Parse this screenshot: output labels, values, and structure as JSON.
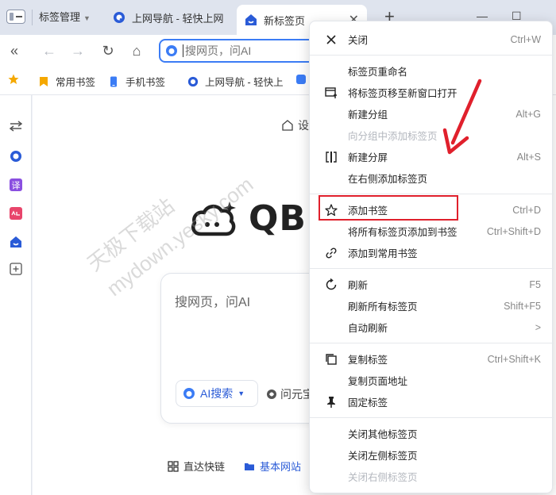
{
  "tabstrip": {
    "tab_manager_label": "标签管理",
    "tabs": [
      {
        "label": "上网导航 - 轻快上网",
        "active": false
      },
      {
        "label": "新标签页",
        "active": true
      }
    ]
  },
  "navbar": {
    "address_placeholder": "搜网页，问AI"
  },
  "bookmarks": {
    "items": [
      {
        "label": "常用书签"
      },
      {
        "label": "手机书签"
      },
      {
        "label": "上网导航 - 轻快上"
      }
    ]
  },
  "sidebar": {
    "icons": [
      "collapse-icon",
      "qbrowser-icon",
      "translate-icon",
      "app-icon",
      "home-icon",
      "add-icon"
    ]
  },
  "content": {
    "settings_label": "设",
    "logo_text": "QB",
    "search_placeholder": "搜网页，问AI",
    "ai_search_label": "AI搜索",
    "wen_label": "问元宝",
    "quick_links": [
      {
        "label": "直达快链"
      },
      {
        "label": "基本网站"
      }
    ],
    "watermark_line1": "天极下载站",
    "watermark_line2": "mydown.yesky.com"
  },
  "menu": {
    "items": [
      {
        "label": "关闭",
        "shortcut": "Ctrl+W",
        "icon": "close-icon",
        "disabled": false
      },
      {
        "label": "标签页重命名",
        "shortcut": "",
        "icon": "",
        "disabled": false
      },
      {
        "label": "将标签页移至新窗口打开",
        "shortcut": "",
        "icon": "move-window-icon",
        "disabled": false
      },
      {
        "label": "新建分组",
        "shortcut": "Alt+G",
        "icon": "",
        "disabled": false
      },
      {
        "label": "向分组中添加标签页",
        "shortcut": "",
        "icon": "",
        "disabled": true
      },
      {
        "label": "新建分屏",
        "shortcut": "Alt+S",
        "icon": "split-screen-icon",
        "disabled": false
      },
      {
        "label": "在右侧添加标签页",
        "shortcut": "",
        "icon": "",
        "disabled": false
      },
      {
        "label": "添加书签",
        "shortcut": "Ctrl+D",
        "icon": "star-icon",
        "disabled": false
      },
      {
        "label": "将所有标签页添加到书签",
        "shortcut": "Ctrl+Shift+D",
        "icon": "",
        "disabled": false
      },
      {
        "label": "添加到常用书签",
        "shortcut": "",
        "icon": "link-icon",
        "disabled": false
      },
      {
        "label": "刷新",
        "shortcut": "F5",
        "icon": "refresh-icon",
        "disabled": false
      },
      {
        "label": "刷新所有标签页",
        "shortcut": "Shift+F5",
        "icon": "",
        "disabled": false
      },
      {
        "label": "自动刷新",
        "shortcut": ">",
        "icon": "",
        "disabled": false
      },
      {
        "label": "复制标签",
        "shortcut": "Ctrl+Shift+K",
        "icon": "copy-icon",
        "disabled": false
      },
      {
        "label": "复制页面地址",
        "shortcut": "",
        "icon": "",
        "disabled": false
      },
      {
        "label": "固定标签",
        "shortcut": "",
        "icon": "pin-icon",
        "disabled": false
      },
      {
        "label": "关闭其他标签页",
        "shortcut": "",
        "icon": "",
        "disabled": false
      },
      {
        "label": "关闭左侧标签页",
        "shortcut": "",
        "icon": "",
        "disabled": false
      },
      {
        "label": "关闭右侧标签页",
        "shortcut": "",
        "icon": "",
        "disabled": true
      }
    ]
  },
  "colors": {
    "accent": "#3b7cf5",
    "highlight_box": "#e0202c",
    "arrow": "#e0202c"
  }
}
